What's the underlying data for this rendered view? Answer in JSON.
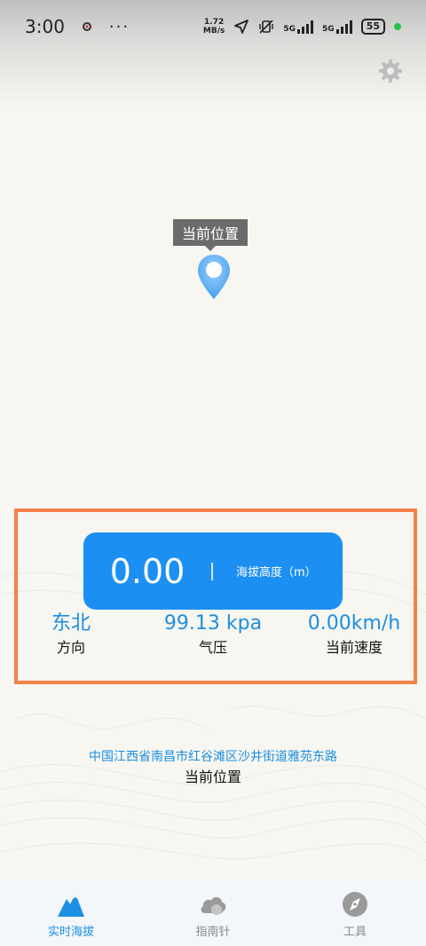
{
  "status_bar": {
    "time": "3:00",
    "dots": "···",
    "net_speed_value": "1.72",
    "net_speed_unit": "MB/s",
    "signal1_label": "5G",
    "signal2_label": "5G",
    "battery": "55"
  },
  "map": {
    "marker_label": "当前位置"
  },
  "altitude": {
    "value": "0.00",
    "label": "海拔高度（m）"
  },
  "stats": [
    {
      "value": "东北",
      "label": "方向"
    },
    {
      "value": "99.13 kpa",
      "label": "气压"
    },
    {
      "value": "0.00km/h",
      "label": "当前速度"
    }
  ],
  "address": {
    "text": "中国江西省南昌市红谷滩区沙井街道雅苑东路",
    "label": "当前位置"
  },
  "tabs": [
    {
      "label": "实时海拔",
      "icon": "mountain-icon",
      "active": true
    },
    {
      "label": "指南针",
      "icon": "cloud-icon",
      "active": false
    },
    {
      "label": "工具",
      "icon": "compass-icon",
      "active": false
    }
  ],
  "colors": {
    "accent": "#1a8fe3",
    "card": "#1c8ff2",
    "highlight": "#f5804a",
    "background": "#f8f6f0"
  }
}
